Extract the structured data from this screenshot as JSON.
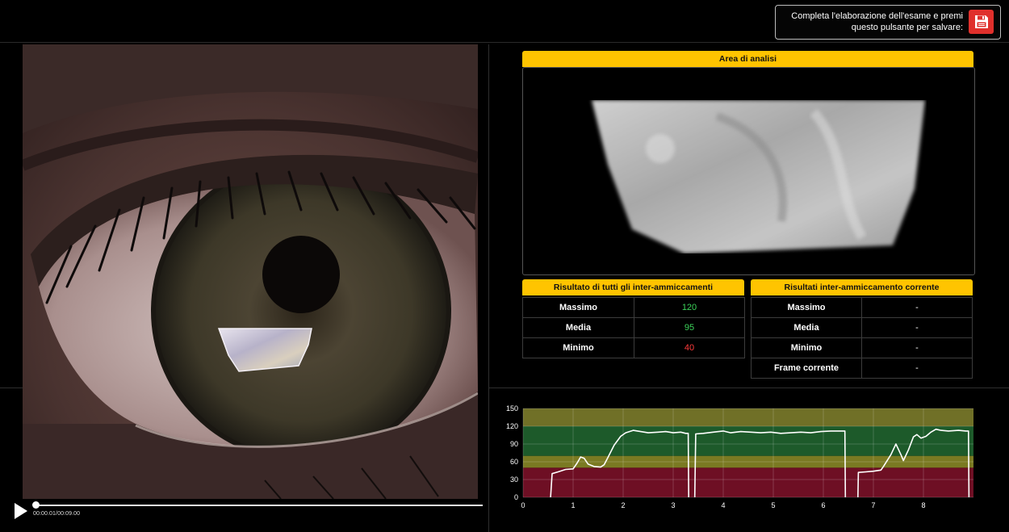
{
  "save": {
    "text_line1": "Completa l'elaborazione dell'esame e premi",
    "text_line2": "questo pulsante per salvare:",
    "icon": "floppy-disk-icon",
    "accent": "#e0302c"
  },
  "video": {
    "timecode": "00:00.01/00:09.00",
    "progress": 0.001,
    "play_icon": "play-icon"
  },
  "analysis": {
    "title": "Area di analisi"
  },
  "all_blinks": {
    "title": "Risultato di tutti gli inter-ammiccamenti",
    "rows": [
      {
        "label": "Massimo",
        "value": "120",
        "color": "#3cd45a"
      },
      {
        "label": "Media",
        "value": "95",
        "color": "#3cd45a"
      },
      {
        "label": "Minimo",
        "value": "40",
        "color": "#ff3b3b"
      }
    ]
  },
  "current_blink": {
    "title": "Risultati inter-ammiccamento corrente",
    "rows": [
      {
        "label": "Massimo",
        "value": "-"
      },
      {
        "label": "Media",
        "value": "-"
      },
      {
        "label": "Minimo",
        "value": "-"
      },
      {
        "label": "Frame corrente",
        "value": "-"
      }
    ]
  },
  "chart_data": {
    "type": "line",
    "xlim": [
      0,
      9
    ],
    "ylim": [
      0,
      150
    ],
    "x_ticks": [
      "0",
      "1",
      "2",
      "3",
      "4",
      "5",
      "6",
      "7",
      "8"
    ],
    "y_ticks": [
      "0",
      "30",
      "60",
      "90",
      "120",
      "150"
    ],
    "grid": true,
    "bands": [
      {
        "from": 0,
        "to": 50,
        "color": "#6e0f24"
      },
      {
        "from": 50,
        "to": 70,
        "color": "#7a7a22"
      },
      {
        "from": 70,
        "to": 120,
        "color": "#1d5a2a"
      },
      {
        "from": 120,
        "to": 150,
        "color": "#707027"
      }
    ],
    "series": [
      {
        "values": [
          [
            0.55,
            0
          ],
          [
            0.58,
            40
          ],
          [
            0.7,
            43
          ],
          [
            0.85,
            47
          ],
          [
            1.0,
            48
          ],
          [
            1.08,
            58
          ],
          [
            1.15,
            68
          ],
          [
            1.22,
            66
          ],
          [
            1.3,
            56
          ],
          [
            1.42,
            52
          ],
          [
            1.55,
            51
          ],
          [
            1.62,
            55
          ],
          [
            1.7,
            68
          ],
          [
            1.82,
            88
          ],
          [
            1.95,
            103
          ],
          [
            2.05,
            109
          ],
          [
            2.2,
            113
          ],
          [
            2.35,
            111
          ],
          [
            2.5,
            109
          ],
          [
            2.7,
            110
          ],
          [
            2.85,
            111
          ],
          [
            3.0,
            109
          ],
          [
            3.15,
            110
          ],
          [
            3.25,
            108
          ],
          [
            3.3,
            108
          ],
          [
            3.31,
            0
          ]
        ]
      },
      {
        "values": [
          [
            3.43,
            0
          ],
          [
            3.45,
            107
          ],
          [
            3.6,
            108
          ],
          [
            3.8,
            110
          ],
          [
            4.0,
            112
          ],
          [
            4.15,
            109
          ],
          [
            4.35,
            111
          ],
          [
            4.55,
            110
          ],
          [
            4.75,
            109
          ],
          [
            4.95,
            110
          ],
          [
            5.15,
            108
          ],
          [
            5.35,
            109
          ],
          [
            5.55,
            110
          ],
          [
            5.75,
            109
          ],
          [
            5.95,
            111
          ],
          [
            6.15,
            112
          ],
          [
            6.3,
            112
          ],
          [
            6.43,
            112
          ],
          [
            6.44,
            0
          ]
        ]
      },
      {
        "values": [
          [
            6.69,
            0
          ],
          [
            6.7,
            42
          ],
          [
            6.85,
            43
          ],
          [
            7.0,
            44
          ],
          [
            7.15,
            46
          ],
          [
            7.2,
            52
          ],
          [
            7.35,
            72
          ],
          [
            7.45,
            90
          ],
          [
            7.55,
            72
          ],
          [
            7.6,
            62
          ],
          [
            7.7,
            80
          ],
          [
            7.8,
            102
          ],
          [
            7.87,
            106
          ],
          [
            7.95,
            100
          ],
          [
            8.05,
            103
          ],
          [
            8.15,
            110
          ],
          [
            8.25,
            115
          ],
          [
            8.35,
            113
          ],
          [
            8.5,
            112
          ],
          [
            8.7,
            113
          ],
          [
            8.85,
            112
          ],
          [
            8.9,
            112
          ],
          [
            8.91,
            0
          ]
        ]
      }
    ]
  }
}
